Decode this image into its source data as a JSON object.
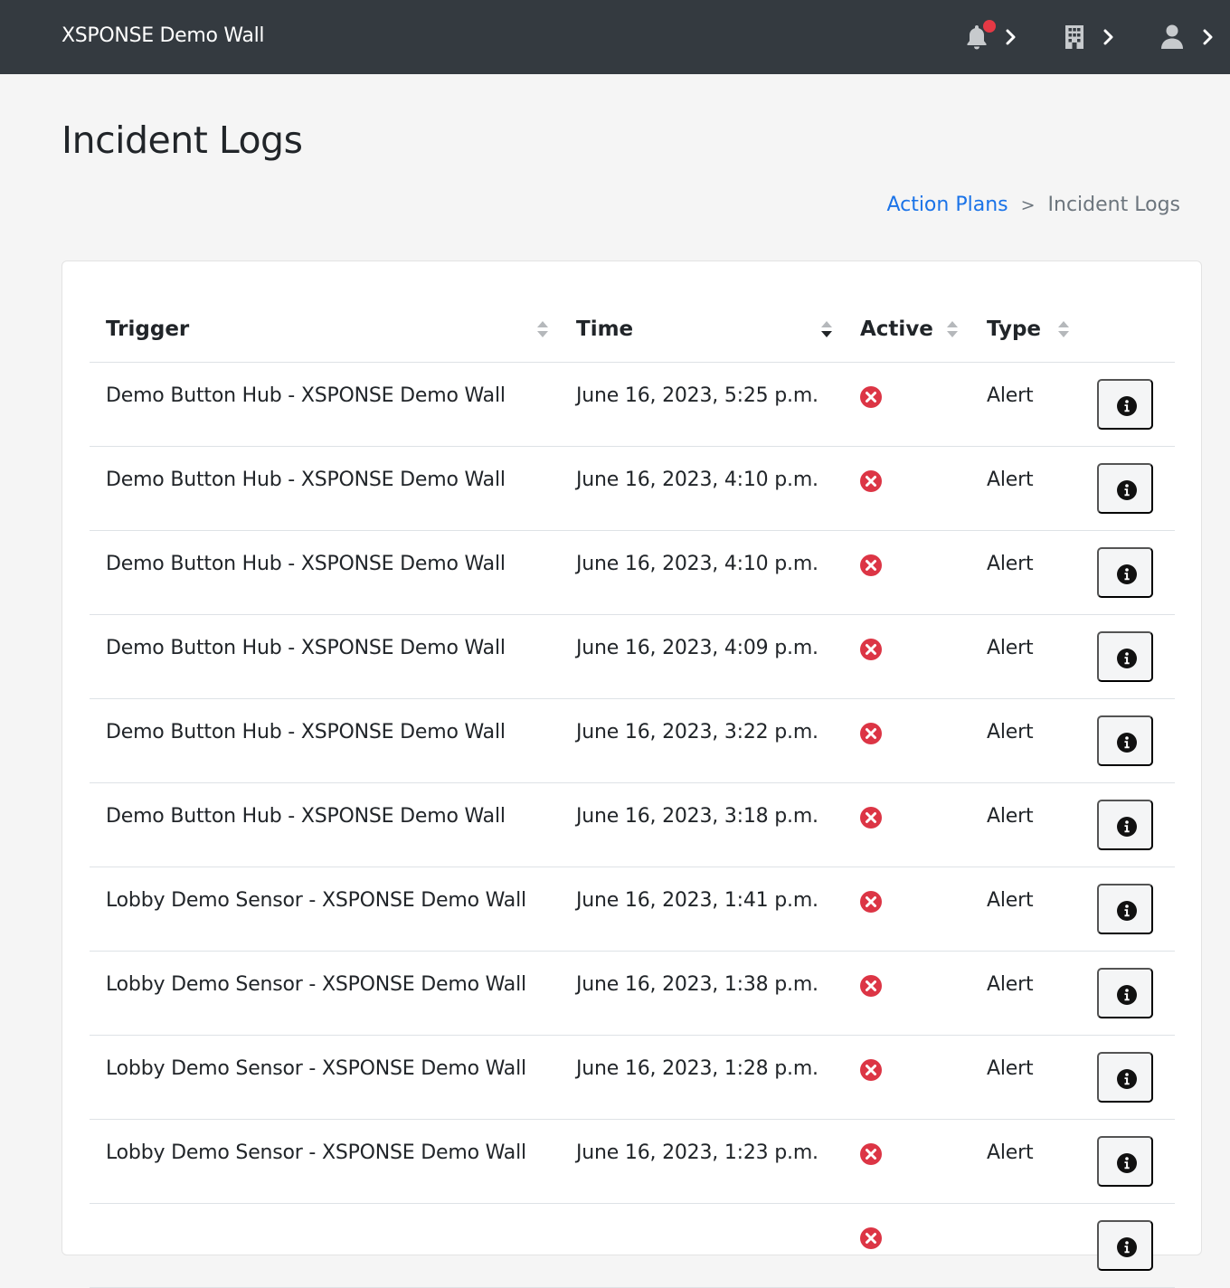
{
  "navbar": {
    "brand": "XSPONSE Demo Wall",
    "icons": [
      "bell-icon",
      "building-icon",
      "user-icon"
    ],
    "notification_dot_color": "#e53945"
  },
  "page": {
    "title": "Incident Logs",
    "breadcrumb": {
      "link": "Action Plans",
      "separator": ">",
      "current": "Incident Logs"
    }
  },
  "table": {
    "columns": [
      {
        "label": "Trigger",
        "sort": "none"
      },
      {
        "label": "Time",
        "sort": "descending"
      },
      {
        "label": "Active",
        "sort": "none"
      },
      {
        "label": "Type",
        "sort": "none"
      }
    ],
    "rows": [
      {
        "trigger": "Demo Button Hub - XSPONSE Demo Wall",
        "time": "June 16, 2023, 5:25 p.m.",
        "active": false,
        "type": "Alert"
      },
      {
        "trigger": "Demo Button Hub - XSPONSE Demo Wall",
        "time": "June 16, 2023, 4:10 p.m.",
        "active": false,
        "type": "Alert"
      },
      {
        "trigger": "Demo Button Hub - XSPONSE Demo Wall",
        "time": "June 16, 2023, 4:10 p.m.",
        "active": false,
        "type": "Alert"
      },
      {
        "trigger": "Demo Button Hub - XSPONSE Demo Wall",
        "time": "June 16, 2023, 4:09 p.m.",
        "active": false,
        "type": "Alert"
      },
      {
        "trigger": "Demo Button Hub - XSPONSE Demo Wall",
        "time": "June 16, 2023, 3:22 p.m.",
        "active": false,
        "type": "Alert"
      },
      {
        "trigger": "Demo Button Hub - XSPONSE Demo Wall",
        "time": "June 16, 2023, 3:18 p.m.",
        "active": false,
        "type": "Alert"
      },
      {
        "trigger": "Lobby Demo Sensor - XSPONSE Demo Wall",
        "time": "June 16, 2023, 1:41 p.m.",
        "active": false,
        "type": "Alert"
      },
      {
        "trigger": "Lobby Demo Sensor - XSPONSE Demo Wall",
        "time": "June 16, 2023, 1:38 p.m.",
        "active": false,
        "type": "Alert"
      },
      {
        "trigger": "Lobby Demo Sensor - XSPONSE Demo Wall",
        "time": "June 16, 2023, 1:28 p.m.",
        "active": false,
        "type": "Alert"
      },
      {
        "trigger": "Lobby Demo Sensor - XSPONSE Demo Wall",
        "time": "June 16, 2023, 1:23 p.m.",
        "active": false,
        "type": "Alert"
      },
      {
        "trigger": "",
        "time": "",
        "active": false,
        "type": ""
      }
    ],
    "inactive_icon": "x-circle-icon",
    "inactive_color": "#dc3545",
    "row_action_icon": "info-icon"
  }
}
